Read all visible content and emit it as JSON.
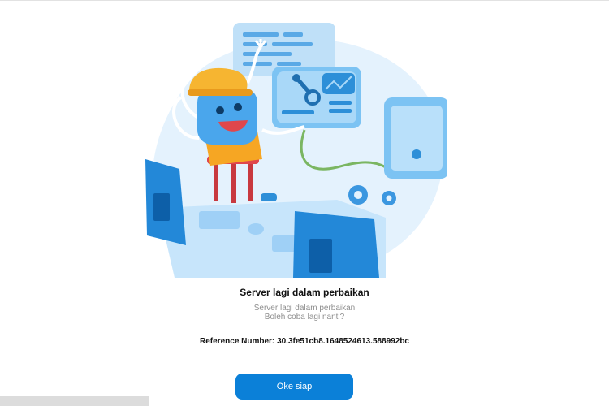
{
  "page": {
    "heading": "Server lagi dalam perbaikan",
    "subtitle_line1": "Server lagi dalam perbaikan",
    "subtitle_line2": "Boleh coba lagi nanti?",
    "reference_label": "Reference Number:",
    "reference_value": "30.3fe51cb8.1648524613.588992bc",
    "button_label": "Oke siap"
  },
  "colors": {
    "accent": "#0b80d8",
    "blob": "#e3f2fd",
    "dark_blue": "#1e88e5",
    "heading": "#111111",
    "subtext": "#8e8e8e"
  },
  "illustration": {
    "name": "maintenance-robot-illustration"
  }
}
